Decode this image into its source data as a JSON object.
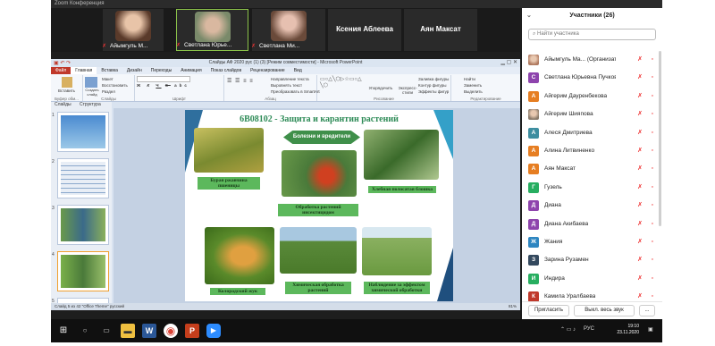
{
  "zoom": {
    "title": "Zoom Конференция"
  },
  "gallery": {
    "tiles": [
      {
        "name": "Айымгуль М...",
        "type": "video",
        "face": "#c48a6a"
      },
      {
        "name": "Светлана Юрье...",
        "type": "video",
        "face": "#9a7a60"
      },
      {
        "name": "Светлана Ми...",
        "type": "video",
        "face": "#b07a6a"
      },
      {
        "name": "Ксения Аблеева",
        "type": "name"
      },
      {
        "name": "Аян Максат",
        "type": "name"
      }
    ],
    "next": "›"
  },
  "ppt": {
    "title": "Слайды АФ 2020 рус (1) (3) [Режим совместимости] - Microsoft PowerPoint",
    "tabs": [
      "Файл",
      "Главная",
      "Вставка",
      "Дизайн",
      "Переходы",
      "Анимация",
      "Показ слайдов",
      "Рецензирование",
      "Вид"
    ],
    "ribbon": {
      "g1": {
        "label": "Буфер обм...",
        "btn": "Вставить"
      },
      "g2": {
        "label": "Слайды",
        "btn": "Создать слайд",
        "items": [
          "Макет",
          "Восстановить",
          "Раздел"
        ]
      },
      "g3": {
        "label": "Шрифт",
        "bold": "Ж",
        "italic": "К",
        "underline": "Ч",
        "strike": "S",
        "shadow": "abc"
      },
      "g4": {
        "label": "Абзац",
        "items": [
          "Направление текста",
          "Выровнять текст",
          "Преобразовать в SmartArt"
        ]
      },
      "g5": {
        "label": "Рисование",
        "items": [
          "Упорядочить",
          "Экспресс-стили"
        ],
        "shape_items": [
          "Заливка фигуры",
          "Контур фигуры",
          "Эффекты фигур"
        ]
      },
      "g6": {
        "label": "Редактирование",
        "items": [
          "Найти",
          "Заменить",
          "Выделить"
        ]
      }
    },
    "pane_tabs": [
      "Слайды",
      "Структура"
    ],
    "slide": {
      "title": "6В08102 - Защита и карантин растений",
      "banner": "Болезни и вредители",
      "captions": [
        "Бурая ржавчина пшеницы",
        "Обработка растений инсектицидом",
        "Хлебная полосатая блошка",
        "Колорадский жук",
        "Химическая обработка растений",
        "Наблюдение за эффектом химической обработки"
      ]
    },
    "status": {
      "left": "Слайд 5 из 42    \"Office Theme\"    русский",
      "zoom": "81%"
    }
  },
  "taskbar": {
    "time": "19:10",
    "date": "23.11.2020",
    "lang": "РУС"
  },
  "participants": {
    "title": "Участники (26)",
    "search_placeholder": "Найти участника",
    "list": [
      {
        "name": "Айымгуль Ма... (Организатор, я)",
        "initial": "",
        "color": "#b07a60",
        "photo": true
      },
      {
        "name": "Светлана Юрьевна Пучкова",
        "initial": "С",
        "color": "#8e44ad"
      },
      {
        "name": "Айгерим Дауренбекова",
        "initial": "А",
        "color": "#e67e22"
      },
      {
        "name": "Айгерим Шияпова",
        "initial": "",
        "color": "#8a7a6a",
        "photo": true
      },
      {
        "name": "Алеся Дмитриева",
        "initial": "А",
        "color": "#3d8ea0"
      },
      {
        "name": "Алина Литвиненко",
        "initial": "А",
        "color": "#e67e22"
      },
      {
        "name": "Аян Максат",
        "initial": "А",
        "color": "#e67e22"
      },
      {
        "name": "Гузель",
        "initial": "Г",
        "color": "#27ae60"
      },
      {
        "name": "Диана",
        "initial": "Д",
        "color": "#8e44ad"
      },
      {
        "name": "Диана Акибаева",
        "initial": "Д",
        "color": "#8e44ad"
      },
      {
        "name": "Жания",
        "initial": "Ж",
        "color": "#2e86c1"
      },
      {
        "name": "Зарина Рузамен",
        "initial": "З",
        "color": "#34495e"
      },
      {
        "name": "Индира",
        "initial": "И",
        "color": "#27ae60"
      },
      {
        "name": "Камила Уралбаева",
        "initial": "К",
        "color": "#c0392b"
      }
    ],
    "invite": "Пригласить",
    "mute_all": "Выкл. весь звук",
    "more": "..."
  }
}
